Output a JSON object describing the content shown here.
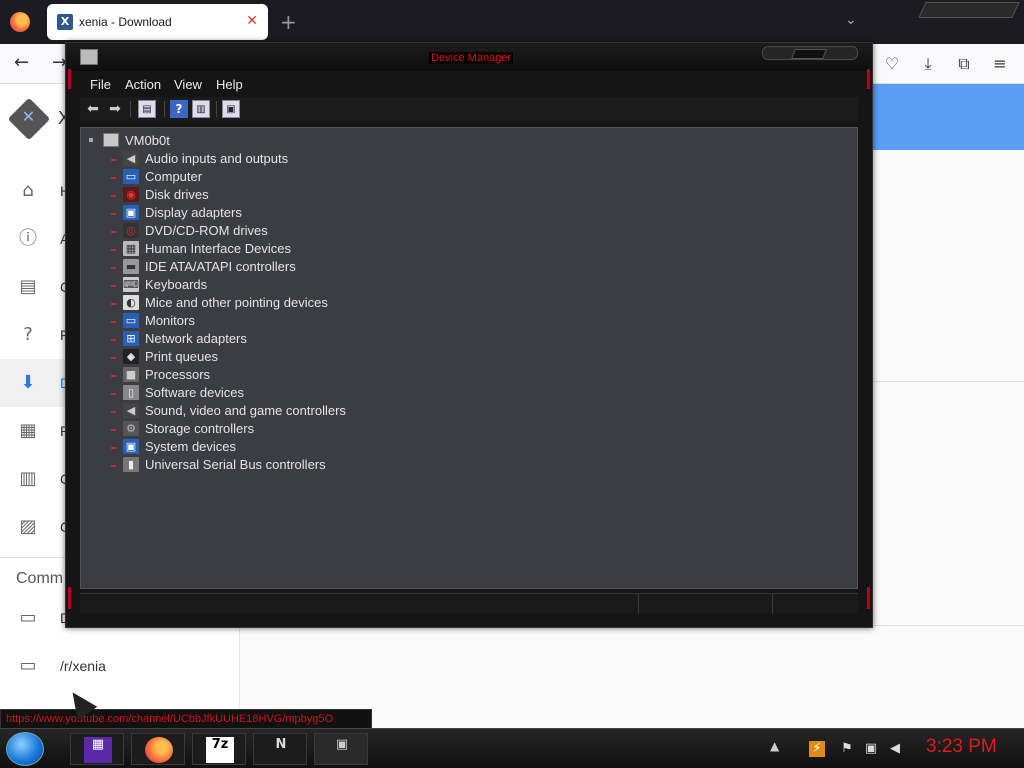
{
  "browser": {
    "tab_title": "xenia - Download",
    "tab_favicon": "X",
    "newtab_glyph": "+",
    "nav_back": "←",
    "nav_forward": "→"
  },
  "site": {
    "name": "X"
  },
  "sidebar": {
    "items": [
      {
        "label": "H",
        "icon": "home-icon"
      },
      {
        "label": "A",
        "icon": "info-icon"
      },
      {
        "label": "C",
        "icon": "clipboard-icon"
      },
      {
        "label": "F",
        "icon": "help-icon"
      },
      {
        "label": "D",
        "icon": "download-icon",
        "active": true
      },
      {
        "label": "R",
        "icon": "calendar-icon"
      },
      {
        "label": "C",
        "icon": "chart-icon"
      },
      {
        "label": "G",
        "icon": "gallery-icon"
      }
    ],
    "section_title": "Comm",
    "community": [
      {
        "label": "D",
        "icon": "chat-icon"
      },
      {
        "label": "/r/xenia",
        "icon": "forum-icon"
      }
    ]
  },
  "device_manager": {
    "title": "Device Manager",
    "menu": [
      "File",
      "Action",
      "View",
      "Help"
    ],
    "root": "VM0b0t",
    "categories": [
      "Audio inputs and outputs",
      "Computer",
      "Disk drives",
      "Display adapters",
      "DVD/CD-ROM drives",
      "Human Interface Devices",
      "IDE ATA/ATAPI controllers",
      "Keyboards",
      "Mice and other pointing devices",
      "Monitors",
      "Network adapters",
      "Print queues",
      "Processors",
      "Software devices",
      "Sound, video and game controllers",
      "Storage controllers",
      "System devices",
      "Universal Serial Bus controllers"
    ]
  },
  "statusbar": {
    "link": "https://www.youtube.com/channel/UCbbJfkUUHE18HVG/mpbyg5O"
  },
  "taskbar": {
    "apps": [
      {
        "name": "cpu-z-icon",
        "glyph": "▦"
      },
      {
        "name": "firefox-icon",
        "glyph": ""
      },
      {
        "name": "7zip-icon",
        "glyph": "7z"
      },
      {
        "name": "tool-icon",
        "glyph": "N"
      },
      {
        "name": "device-manager-icon",
        "glyph": "▣"
      }
    ],
    "clock": "3:23 PM"
  },
  "colors": {
    "accent_red": "#e01020",
    "active_blue": "#2b78e4",
    "header_blue": "#5a9ef5"
  }
}
